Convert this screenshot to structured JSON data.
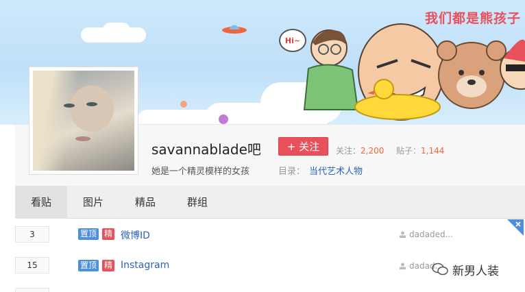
{
  "banner": {
    "slogan": "我们都是熊孩子",
    "hi_text": "Hi~"
  },
  "forum": {
    "name": "savannablade吧",
    "follow_label": "+ 关注",
    "follow_stat_label": "关注：",
    "follow_count": "2,200",
    "post_stat_label": "贴子：",
    "post_count": "1,144",
    "slogan": "她是一个精灵模样的女孩",
    "directory_label": "目录：",
    "directory_value": "当代艺术人物"
  },
  "tabs": [
    {
      "label": "看贴",
      "active": true
    },
    {
      "label": "图片",
      "active": false
    },
    {
      "label": "精品",
      "active": false
    },
    {
      "label": "群组",
      "active": false
    }
  ],
  "threads": [
    {
      "replies": "3",
      "tags": [
        "置顶",
        "精"
      ],
      "title": "微博ID",
      "author": "dadaded..."
    },
    {
      "replies": "15",
      "tags": [
        "置顶",
        "精"
      ],
      "title": "Instagram",
      "author": "dadad..."
    }
  ],
  "watermark": {
    "text": "新男人装"
  },
  "colors": {
    "accent_red": "#e8505b",
    "link_blue": "#2d64b3",
    "stat_orange": "#f0663c",
    "tag_blue": "#4f8fd6"
  }
}
